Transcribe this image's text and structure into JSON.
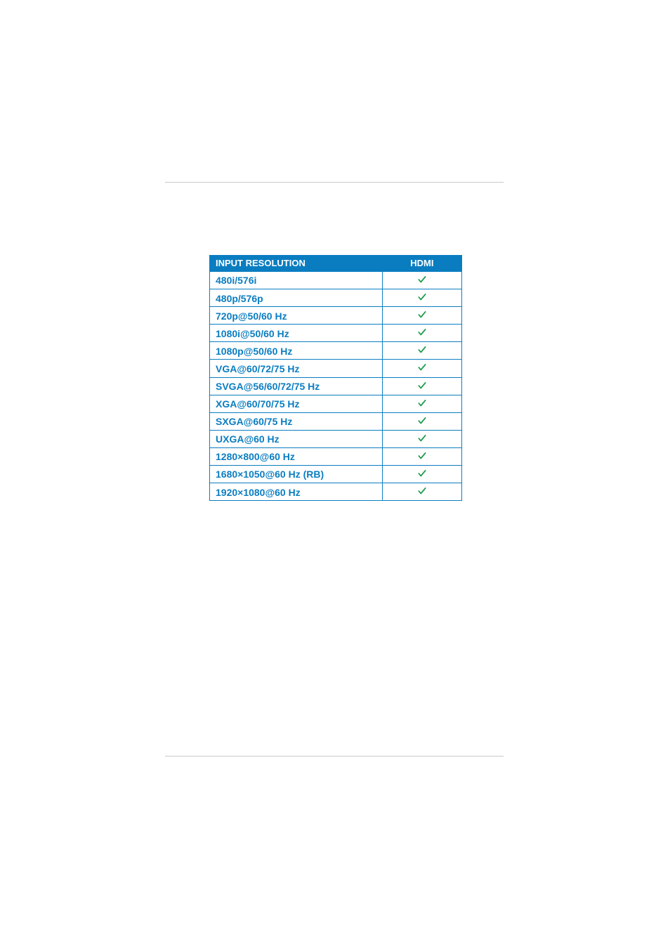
{
  "chart_data": {
    "type": "table",
    "title": "",
    "columns": [
      "INPUT RESOLUTION",
      "HDMI"
    ],
    "rows": [
      {
        "resolution": "480i/576i",
        "hdmi": true
      },
      {
        "resolution": "480p/576p",
        "hdmi": true
      },
      {
        "resolution": "720p@50/60 Hz",
        "hdmi": true
      },
      {
        "resolution": "1080i@50/60 Hz",
        "hdmi": true
      },
      {
        "resolution": "1080p@50/60 Hz",
        "hdmi": true
      },
      {
        "resolution": "VGA@60/72/75 Hz",
        "hdmi": true
      },
      {
        "resolution": "SVGA@56/60/72/75 Hz",
        "hdmi": true
      },
      {
        "resolution": "XGA@60/70/75 Hz",
        "hdmi": true
      },
      {
        "resolution": "SXGA@60/75 Hz",
        "hdmi": true
      },
      {
        "resolution": "UXGA@60 Hz",
        "hdmi": true
      },
      {
        "resolution": "1280×800@60 Hz",
        "hdmi": true
      },
      {
        "resolution": "1680×1050@60 Hz (RB)",
        "hdmi": true
      },
      {
        "resolution": "1920×1080@60 Hz",
        "hdmi": true
      }
    ]
  },
  "table": {
    "headers": {
      "input_resolution": "INPUT RESOLUTION",
      "hdmi": "HDMI"
    }
  },
  "colors": {
    "brand_blue": "#0a7dc1",
    "rule_gray": "#c9c9c9",
    "check_green": "#1a9a47"
  }
}
